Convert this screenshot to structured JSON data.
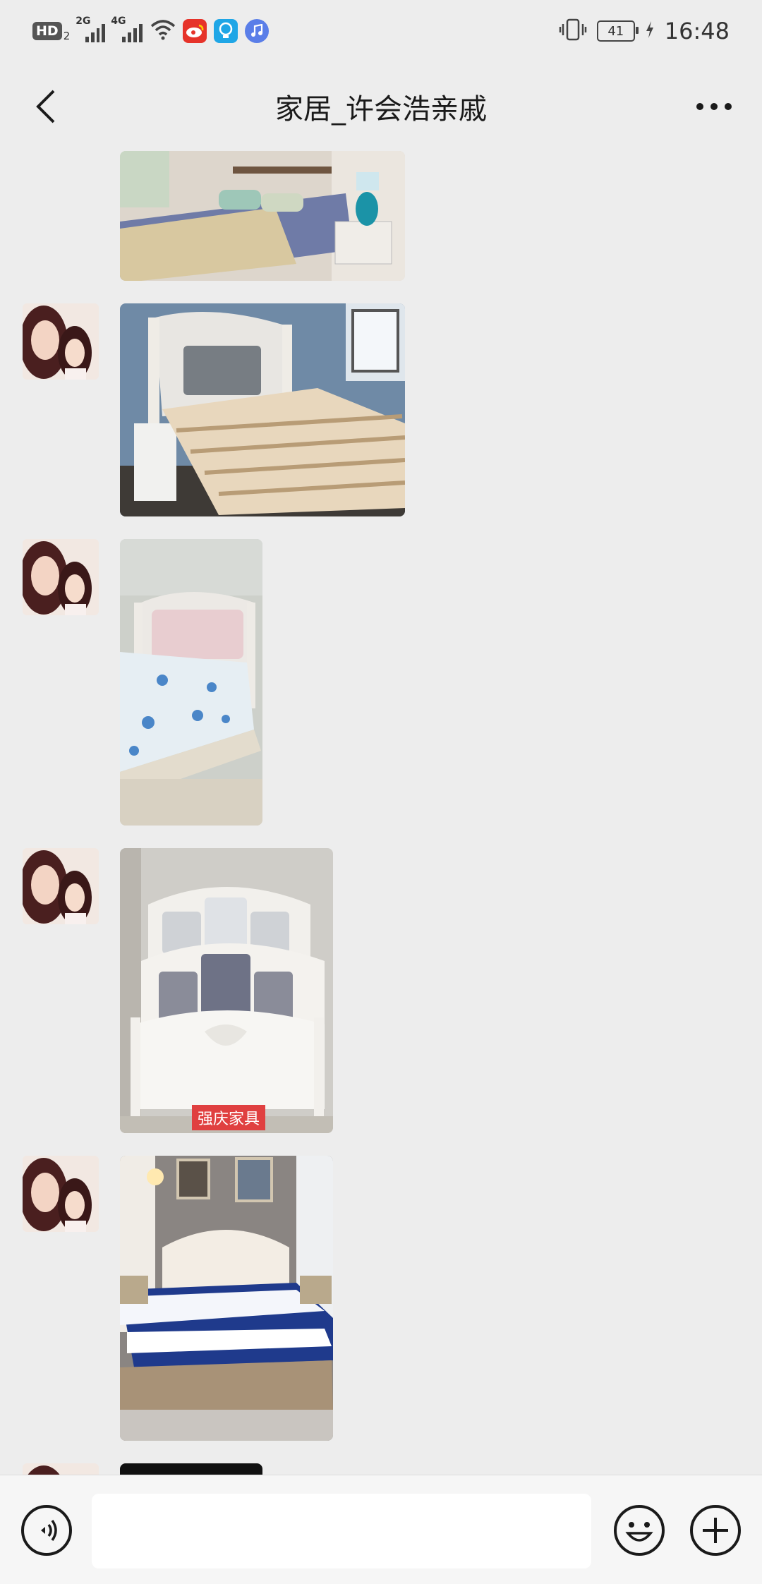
{
  "status_bar": {
    "hd_label": "HD",
    "hd_sub": "2",
    "signal1_label": "2G",
    "signal2_label": "4G",
    "battery": "41",
    "time": "16:48",
    "icons": [
      "wifi-icon",
      "weibo-app-icon",
      "bulb-app-icon",
      "music-app-icon",
      "vibrate-icon",
      "charging-icon"
    ]
  },
  "header": {
    "title": "家居_许会浩亲戚",
    "back_icon": "chevron-left-icon",
    "more_icon": "more-dots-icon"
  },
  "messages": [
    {
      "type": "image",
      "sender": "contact",
      "content": "bedroom with grey bed, knit blanket and teal lamp"
    },
    {
      "type": "image",
      "sender": "contact",
      "content": "white carved bed frame with pine slats"
    },
    {
      "type": "image",
      "sender": "contact",
      "content": "pink upholstered bed with floral mattress cover"
    },
    {
      "type": "image",
      "sender": "contact",
      "content": "three stacked white carved headboards",
      "watermark": "强庆家具"
    },
    {
      "type": "image",
      "sender": "contact",
      "content": "tufted bed with blue mattress in bedroom"
    }
  ],
  "input_bar": {
    "voice_icon": "voice-icon",
    "input_value": "",
    "emoji_icon": "emoji-icon",
    "plus_icon": "plus-icon"
  },
  "colors": {
    "background": "#ededed",
    "input_bar": "#f6f6f6",
    "watermark": "#e04040"
  }
}
